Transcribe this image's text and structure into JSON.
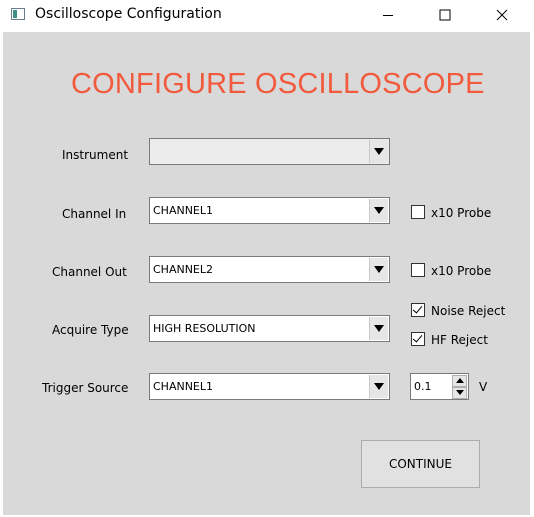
{
  "window": {
    "title": "Oscilloscope Configuration",
    "icon": "app-window-icon",
    "controls": [
      "minimize-icon",
      "maximize-icon",
      "close-icon"
    ]
  },
  "heading": "CONFIGURE OSCILLOSCOPE",
  "colors": {
    "heading": "#f15a3c",
    "client_background": "#d9d9d9"
  },
  "form": {
    "instrument": {
      "label": "Instrument",
      "value": ""
    },
    "channel_in": {
      "label": "Channel In",
      "value": "CHANNEL1",
      "probe_label": "x10 Probe",
      "probe_checked": false
    },
    "channel_out": {
      "label": "Channel Out",
      "value": "CHANNEL2",
      "probe_label": "x10 Probe",
      "probe_checked": false
    },
    "acquire_type": {
      "label": "Acquire Type",
      "value": "HIGH RESOLUTION"
    },
    "noise_reject": {
      "label": "Noise Reject",
      "checked": true
    },
    "hf_reject": {
      "label": "HF Reject",
      "checked": true
    },
    "trigger_source": {
      "label": "Trigger Source",
      "value": "CHANNEL1"
    },
    "trigger_level": {
      "value": "0.1",
      "unit": "V"
    }
  },
  "continue_label": "CONTINUE"
}
